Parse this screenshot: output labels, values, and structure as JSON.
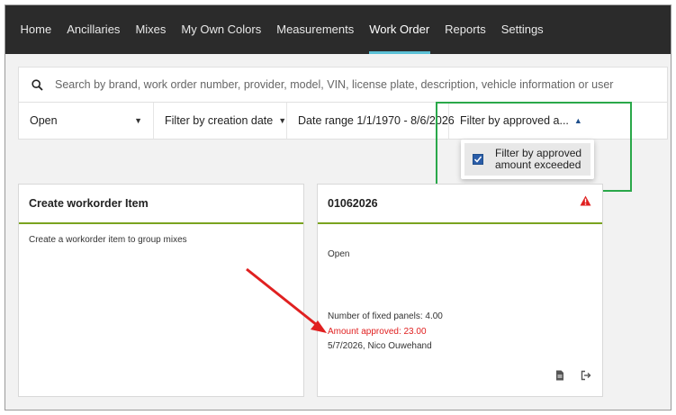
{
  "nav": {
    "items": [
      {
        "label": "Home"
      },
      {
        "label": "Ancillaries"
      },
      {
        "label": "Mixes"
      },
      {
        "label": "My Own Colors"
      },
      {
        "label": "Measurements"
      },
      {
        "label": "Work Order",
        "active": true
      },
      {
        "label": "Reports"
      },
      {
        "label": "Settings"
      }
    ]
  },
  "search": {
    "placeholder": "Search by brand, work order number, provider, model, VIN, license plate, description, vehicle information or user",
    "icon": "search-icon"
  },
  "filters": {
    "status": "Open",
    "creation_date": "Filter by creation date",
    "date_range": "Date range 1/1/1970 - 8/6/2026",
    "approved": "Filter by approved a..."
  },
  "dropdown": {
    "option_label_line1": "Filter by approved",
    "option_label_line2": "amount exceeded",
    "checked": true
  },
  "cards": {
    "create": {
      "title": "Create workorder Item",
      "description": "Create a workorder item to group mixes"
    },
    "order": {
      "title": "01062026",
      "status": "Open",
      "fixed_panels": "Number of fixed panels: 4.00",
      "amount_approved": "Amount approved: 23.00",
      "meta": "5/7/2026, Nico Ouwehand"
    }
  },
  "colors": {
    "nav_bg": "#2b2b2b",
    "active_underline": "#5bc0d6",
    "card_accent": "#7aa31f",
    "highlight_box": "#2aa84a",
    "warning": "#e02020"
  }
}
